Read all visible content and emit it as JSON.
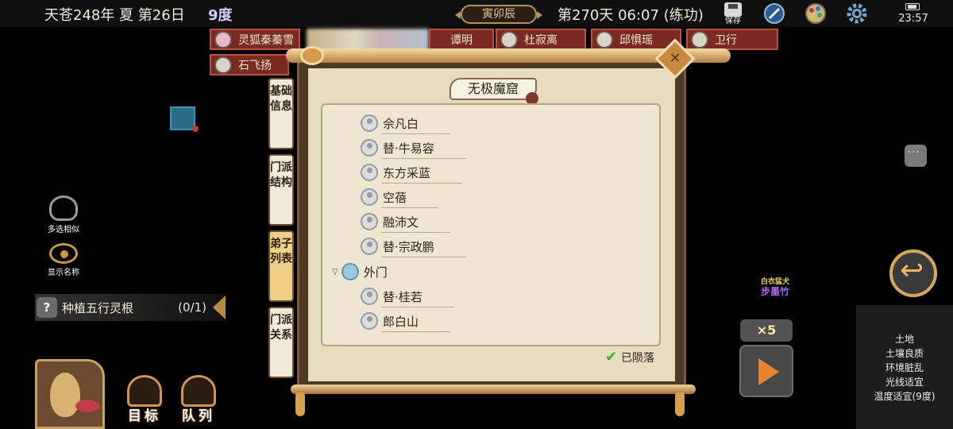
{
  "topbar": {
    "date": "天苍248年 夏 第26日",
    "temperature": "9度",
    "era": "寅卯辰",
    "day_time": "第270天 06:07 (练功)",
    "save_label": "保存",
    "clock": "23:57"
  },
  "characters": [
    {
      "name": "灵狐秦蓁雪",
      "avatar": "fox-avatar"
    },
    {
      "name": "谭明"
    },
    {
      "name": "杜寂离"
    },
    {
      "name": "邱惧瑶"
    },
    {
      "name": "卫行"
    },
    {
      "name": "石飞扬"
    }
  ],
  "left_tools": {
    "multi_select": "多选相似",
    "show_names": "显示名称"
  },
  "quest": {
    "icon": "?",
    "title": "种植五行灵根",
    "progress": "(0/1)"
  },
  "bottom_buttons": {
    "target": "目标",
    "queue": "队列"
  },
  "panel": {
    "title": "无极魔窟",
    "side_tabs": [
      "基础信息",
      "门派结构",
      "弟子列表",
      "门派关系"
    ],
    "active_tab": 2,
    "members_top": [
      "佘凡白",
      "替·牛易容",
      "东方采蓝",
      "空蓓",
      "融沛文",
      "替·宗政鹏"
    ],
    "group_label": "外门",
    "members_outer": [
      "替·桂若",
      "郎白山"
    ],
    "fallen_label": "已陨落",
    "fallen_checked": true
  },
  "npc": {
    "title": "白衣猛犬",
    "name": "步墨竹"
  },
  "speed": "×5",
  "environment": [
    "土地",
    "土壤良质",
    "环境脏乱",
    "光线适宜",
    "温度适宜(9度)"
  ],
  "colors": {
    "char_tab": "#7a2a22",
    "parchment": "#e8dcc0",
    "accent_gold": "#d6a75c",
    "play_orange": "#e3862f",
    "npc_name": "#a86af2"
  }
}
